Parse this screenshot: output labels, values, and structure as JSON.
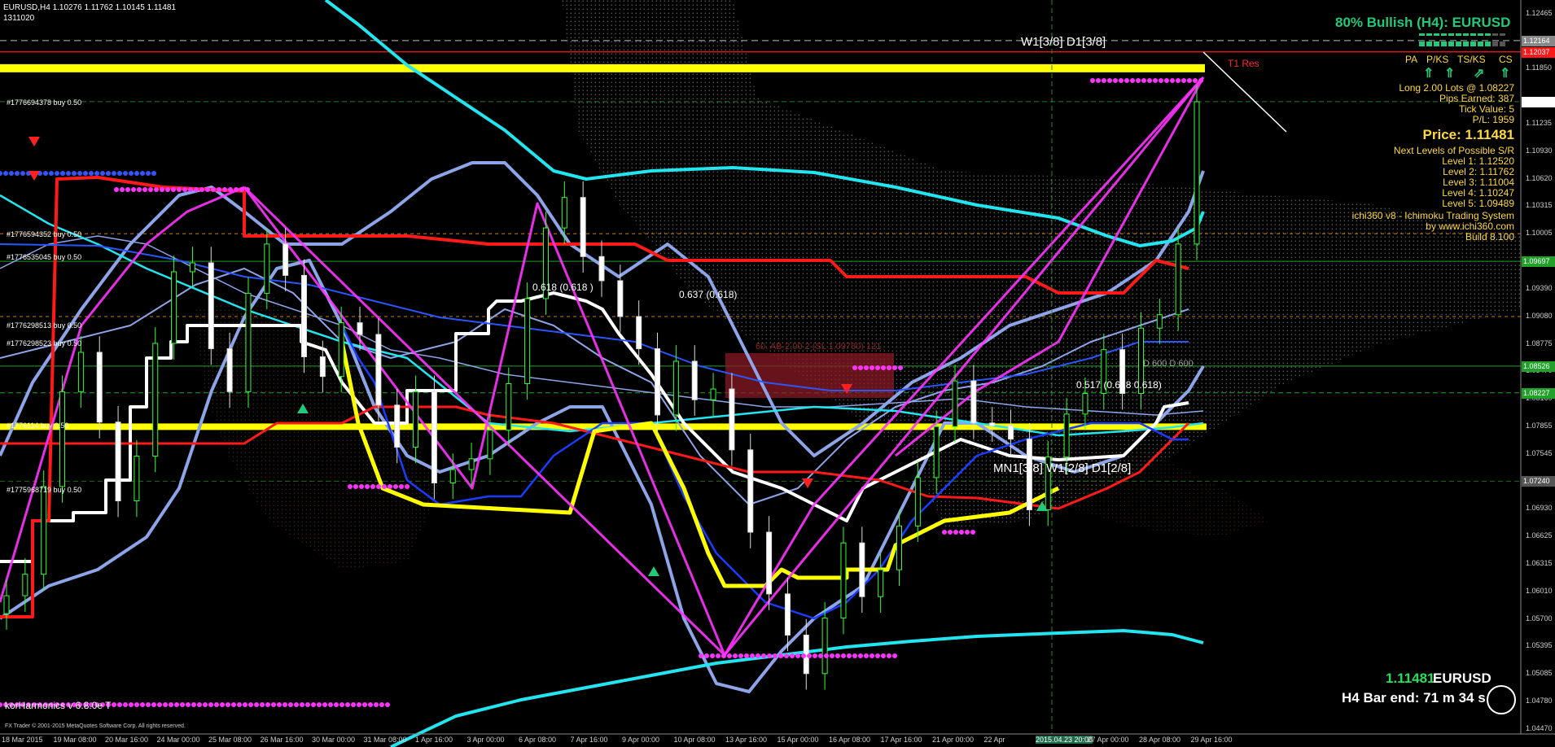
{
  "header": {
    "symbol_line": "EURUSD,H4  1.10276 1.11762 1.10145 1.11481",
    "sub_line": "1311020"
  },
  "panel": {
    "bullish_title": "80% Bullish (H4): EURUSD",
    "pa_headers": [
      "PA",
      "P/KS",
      "TS/KS",
      "CS"
    ],
    "trade_info": [
      "Long 2.00 Lots @ 1.08227",
      "Pips Earned: 387",
      "Tick Value: 5",
      "P/L: 1959"
    ],
    "price_label": "Price: 1.11481",
    "sr_title": "Next Levels of Possible S/R",
    "levels": [
      "Level 1: 1.12520",
      "Level 2: 1.11762",
      "Level 3: 1.11004",
      "Level 4: 1.10247",
      "Level 5: 1.09489"
    ],
    "system_lines": [
      "ichi360 v8 - Ichimoku Trading System",
      "by www.ichi360.com",
      "Build 8.100"
    ]
  },
  "annotations": {
    "w1d1_top": "W1[3/8] D1[3/8]",
    "mn1_bottom": "MN1[3/8] W1[2/8] D1[2/8]",
    "res_label": "T1 Res",
    "fib_1": "0.618 (0.618 )",
    "fib_2": "0.637 (0.618)",
    "pattern_label": "60. AB-2.00 2 (SL 1.09780) 121",
    "fib_3": "0.517 (0.618 0.618)",
    "fib_4": "D 600 D 600"
  },
  "orders": [
    "#1776694378 buy 0.50",
    "#1776594352 buy 0.50",
    "#1776535045 buy 0.50",
    "#1776298513 buy 0.50",
    "#1776298523 buy 0.50",
    "#1776114 buy 0.50",
    "#1775968719 buy 0.50"
  ],
  "clock": {
    "price": "1.11481",
    "symbol": "EURUSD",
    "bar_end": "H4 Bar end: 71 m 34 s"
  },
  "footer": {
    "harmonics": "korHarmonics v 6.8.0e T",
    "copyright": "FX Trader © 2001-2015 MetaQuotes Software Corp. All rights reserved."
  },
  "colors": {
    "background": "#000000",
    "bull_candle": "#33ff33",
    "yellow_line": "#ffff00",
    "red_line": "#ff1a1a",
    "white_line": "#ffffff",
    "cyan_line": "#22e5f0",
    "bollinger": "#8ea4e8",
    "magenta": "#ff33ff",
    "blue_line": "#1a3cff",
    "cloud_dots": "#c8c8c8",
    "accent_green": "#22c97a",
    "panel_text": "#ffd83a"
  },
  "chart_data": {
    "type": "candlestick",
    "symbol": "EURUSD",
    "timeframe": "H4",
    "ohlc_header": {
      "open": 1.10276,
      "high": 1.11762,
      "low": 1.10145,
      "close": 1.11481
    },
    "ylim": [
      1.04415,
      1.12617
    ],
    "y_ticks": [
      "1.12465",
      "1.12164",
      "1.11850",
      "1.11481",
      "1.11235",
      "1.10930",
      "1.10620",
      "1.10315",
      "1.10005",
      "1.09697",
      "1.09390",
      "1.09080",
      "1.08775",
      "1.08470",
      "1.08160",
      "1.07855",
      "1.07545",
      "1.07240",
      "1.06930",
      "1.06625",
      "1.06315",
      "1.06010",
      "1.05700",
      "1.05395",
      "1.05085",
      "1.04780",
      "1.04470"
    ],
    "x_ticks": [
      "18 Mar 2015",
      "19 Mar 08:00",
      "20 Mar 16:00",
      "24 Mar 00:00",
      "25 Mar 08:00",
      "26 Mar 16:00",
      "30 Mar 00:00",
      "31 Mar 08:00",
      "1 Apr 16:00",
      "3 Apr 00:00",
      "6 Apr 08:00",
      "7 Apr 16:00",
      "9 Apr 00:00",
      "10 Apr 08:00",
      "13 Apr 16:00",
      "15 Apr 00:00",
      "16 Apr 08:00",
      "17 Apr 16:00",
      "21 Apr 00:00",
      "22 Apr",
      "2015.04.23 20:00",
      "27 Apr 00:00",
      "28 Apr 08:00",
      "29 Apr 16:00"
    ],
    "price_boxes": [
      {
        "label": "1.12164",
        "color": "#888888"
      },
      {
        "label": "1.12037",
        "color": "#ff1a1a"
      },
      {
        "label": "1.11481",
        "color": "#ffffff"
      },
      {
        "label": "1.09697",
        "color": "#22a02a"
      },
      {
        "label": "1.08526",
        "color": "#22a02a"
      },
      {
        "label": "1.08227",
        "color": "#22a02a"
      },
      {
        "label": "1.07240",
        "color": "#555555"
      }
    ],
    "closes": [
      1.0596,
      1.062,
      1.0718,
      1.0824,
      1.0868,
      1.079,
      1.0702,
      1.0752,
      1.0878,
      1.0958,
      1.0968,
      1.0872,
      1.0824,
      1.0934,
      1.0989,
      1.0954,
      1.0863,
      1.0841,
      1.0901,
      1.0888,
      1.0809,
      1.0762,
      1.0824,
      1.0722,
      1.0737,
      1.0749,
      1.0781,
      1.0833,
      1.0928,
      1.1007,
      1.1041,
      1.0975,
      1.0948,
      1.0908,
      1.0872,
      1.0798,
      1.0858,
      1.0815,
      1.0827,
      1.0759,
      1.0667,
      1.0598,
      1.0552,
      1.0509,
      1.0571,
      1.0655,
      1.0595,
      1.0625,
      1.0674,
      1.0728,
      1.0785,
      1.0836,
      1.0789,
      1.0786,
      1.0771,
      1.0692,
      1.0751,
      1.0799,
      1.0822,
      1.0871,
      1.0822,
      1.0895,
      1.091,
      1.0989,
      1.1148
    ]
  }
}
